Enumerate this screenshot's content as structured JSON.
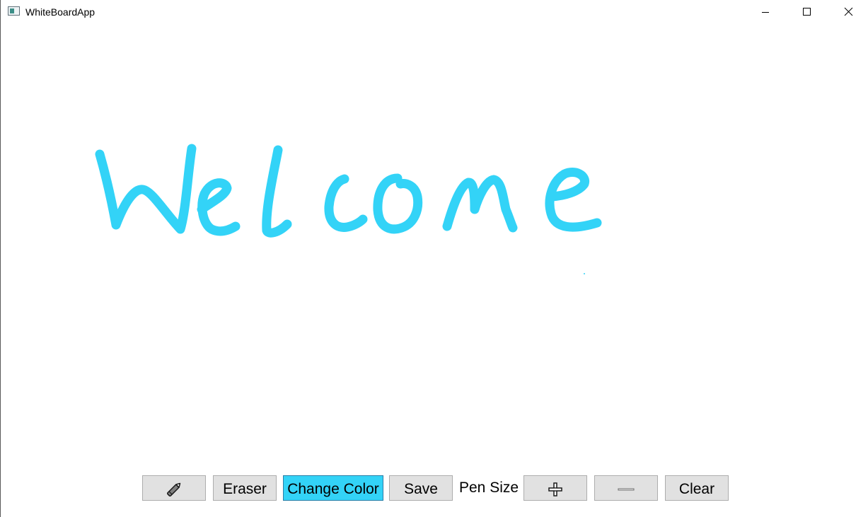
{
  "window": {
    "title": "WhiteBoardApp",
    "controls": [
      "minimize-icon",
      "maximize-icon",
      "close-icon"
    ]
  },
  "canvas": {
    "ink_color": "#33d3f7",
    "background": "#ffffff"
  },
  "toolbar": {
    "pen_icon": "pencil-icon",
    "eraser_label": "Eraser",
    "change_color_label": "Change Color",
    "save_label": "Save",
    "pen_size_label": "Pen Size",
    "increase_icon": "plus-icon",
    "decrease_icon": "minus-icon",
    "clear_label": "Clear",
    "active_color": "#33d3f7"
  }
}
